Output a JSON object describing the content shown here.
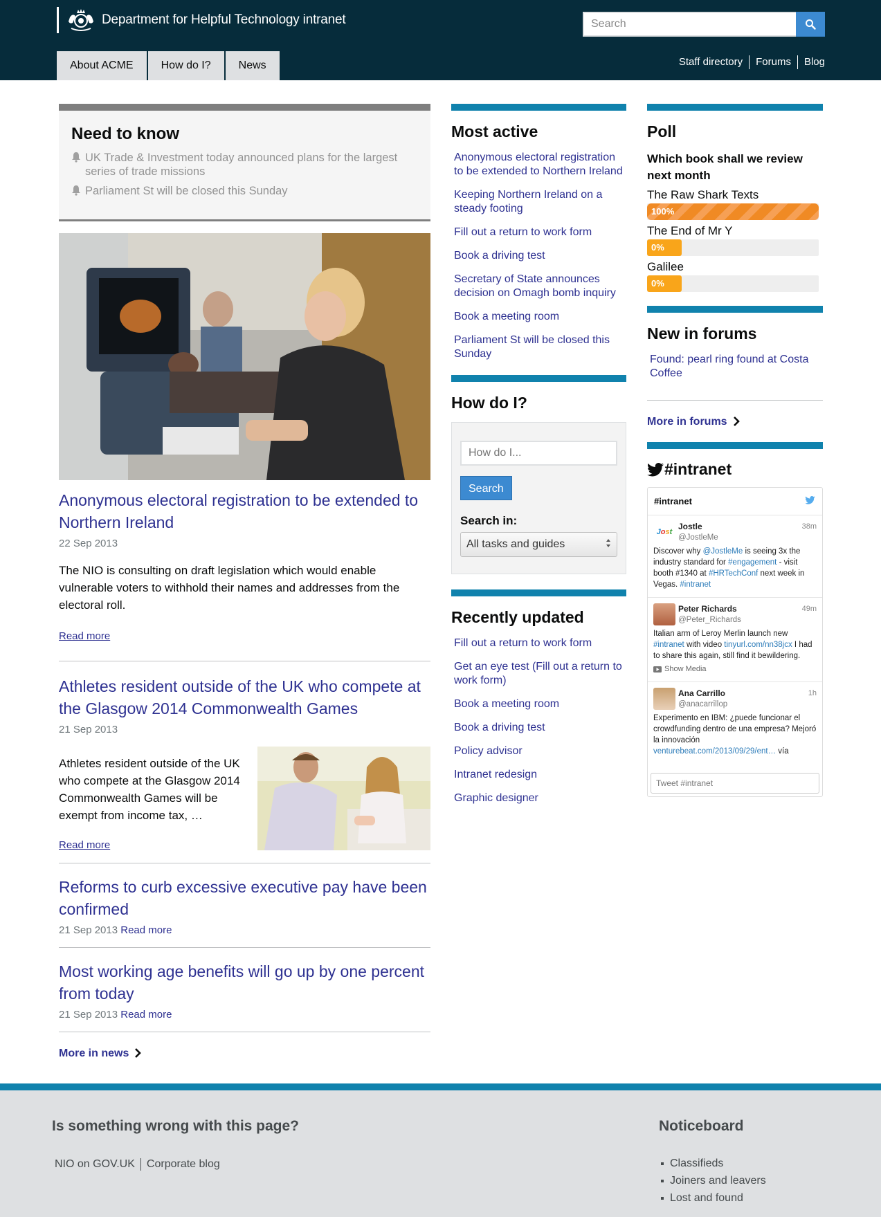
{
  "header": {
    "title": "Department for Helpful Technology intranet",
    "search_placeholder": "Search",
    "tabs": [
      "About ACME",
      "How do I?",
      "News"
    ],
    "util_links": [
      "Staff directory",
      "Forums",
      "Blog"
    ]
  },
  "need_to_know": {
    "heading": "Need to know",
    "items": [
      "UK Trade & Investment today announced plans for the largest series of trade missions",
      "Parliament St will be closed this Sunday"
    ]
  },
  "news": [
    {
      "title": "Anonymous electoral registration to be extended to Northern Ireland",
      "date": "22 Sep 2013",
      "summary": "The NIO is consulting on draft legislation which would enable vulnerable voters to withhold their names and addresses from the electoral roll.",
      "read_more": "Read more"
    },
    {
      "title": "Athletes resident outside of the UK who compete at the Glasgow 2014 Commonwealth Games",
      "date": "21 Sep 2013",
      "summary": "Athletes resident outside of the UK who compete at the Glasgow 2014 Commonwealth Games will be exempt from income tax, …",
      "read_more": "Read more"
    },
    {
      "title": "Reforms to curb excessive executive pay have been confirmed",
      "date": "21 Sep 2013",
      "read_more": "Read more"
    },
    {
      "title": "Most working age benefits will go up by one percent from today",
      "date": "21 Sep 2013",
      "read_more": "Read more"
    }
  ],
  "more_in_news": "More in news",
  "most_active": {
    "heading": "Most active",
    "links": [
      "Anonymous electoral registration to be extended to Northern Ireland",
      "Keeping Northern Ireland on a steady footing",
      "Fill out a return to work form",
      "Book a driving test",
      "Secretary of State announces decision on Omagh bomb inquiry",
      "Book a meeting room",
      "Parliament St will be closed this Sunday"
    ]
  },
  "how_do_i": {
    "heading": "How do I?",
    "placeholder": "How do I...",
    "button": "Search",
    "search_in_label": "Search in:",
    "select_value": "All tasks and guides"
  },
  "recently_updated": {
    "heading": "Recently updated",
    "links": [
      "Fill out a return to work form",
      "Get an eye test (Fill out a return to work form)",
      "Book a meeting room",
      "Book a driving test",
      "Policy advisor",
      "Intranet redesign",
      "Graphic designer"
    ]
  },
  "poll": {
    "heading": "Poll",
    "question": "Which book shall we review next month",
    "options": [
      {
        "label": "The Raw Shark Texts",
        "percent": 100,
        "percent_label": "100%"
      },
      {
        "label": "The End of Mr Y",
        "percent": 0,
        "percent_label": "0%"
      },
      {
        "label": "Galilee",
        "percent": 0,
        "percent_label": "0%"
      }
    ]
  },
  "forums": {
    "heading": "New in forums",
    "link": "Found: pearl ring found at Costa Coffee",
    "more": "More in forums"
  },
  "twitter": {
    "heading": "#intranet",
    "widget_title": "#intranet",
    "compose_placeholder": "Tweet #intranet",
    "tweets": [
      {
        "name": "Jostle",
        "handle": "@JostleMe",
        "time": "38m",
        "parts": [
          "Discover why ",
          "@JostleMe",
          " is seeing 3x the industry standard for ",
          "#engagement",
          " - visit booth #1340 at ",
          "#HRTechConf",
          " next week in Vegas. ",
          "#intranet"
        ]
      },
      {
        "name": "Peter Richards",
        "handle": "@Peter_Richards",
        "time": "49m",
        "parts": [
          "Italian arm of Leroy Merlin launch new ",
          "#intranet",
          " with video ",
          "tinyurl.com/nn38jcx",
          " I had to share this again, still find it bewildering."
        ],
        "show_media": "Show Media"
      },
      {
        "name": "Ana Carrillo",
        "handle": "@anacarrillop",
        "time": "1h",
        "parts": [
          "Experimento en IBM: ¿puede funcionar el crowdfunding dentro de una empresa? Mejoró la innovación ",
          "venturebeat.com/2013/09/29/ent…",
          " vía"
        ]
      }
    ]
  },
  "footer": {
    "heading": "Is something wrong with this page?",
    "links": [
      "NIO on GOV.UK",
      "Corporate blog"
    ],
    "noticeboard_heading": "Noticeboard",
    "noticeboard_items": [
      "Classifieds",
      "Joiners and leavers",
      "Lost and found"
    ]
  },
  "colors": {
    "header_bg": "#062c3b",
    "accent_bar": "#1082ad",
    "link": "#2e3191",
    "button": "#3c8ad1",
    "poll_fill": "#f08a24"
  }
}
